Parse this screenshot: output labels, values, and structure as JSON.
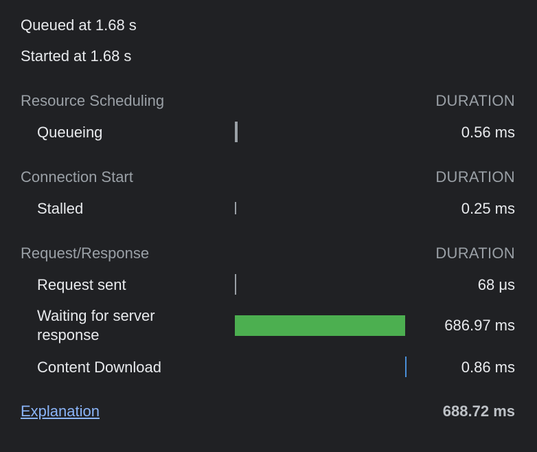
{
  "queued": "Queued at 1.68 s",
  "started": "Started at 1.68 s",
  "sections": [
    {
      "title": "Resource Scheduling",
      "duration_header": "DURATION",
      "rows": [
        {
          "label": "Queueing",
          "value": "0.56 ms"
        }
      ]
    },
    {
      "title": "Connection Start",
      "duration_header": "DURATION",
      "rows": [
        {
          "label": "Stalled",
          "value": "0.25 ms"
        }
      ]
    },
    {
      "title": "Request/Response",
      "duration_header": "DURATION",
      "rows": [
        {
          "label": "Request sent",
          "value": "68 μs"
        },
        {
          "label": "Waiting for server response",
          "value": "686.97 ms"
        },
        {
          "label": "Content Download",
          "value": "0.86 ms"
        }
      ]
    }
  ],
  "explanation": "Explanation",
  "total": "688.72 ms",
  "colors": {
    "background": "#202124",
    "waiting_bar": "#4caf50",
    "download_bar": "#4a8fd8",
    "tick": "#9aa0a6"
  }
}
